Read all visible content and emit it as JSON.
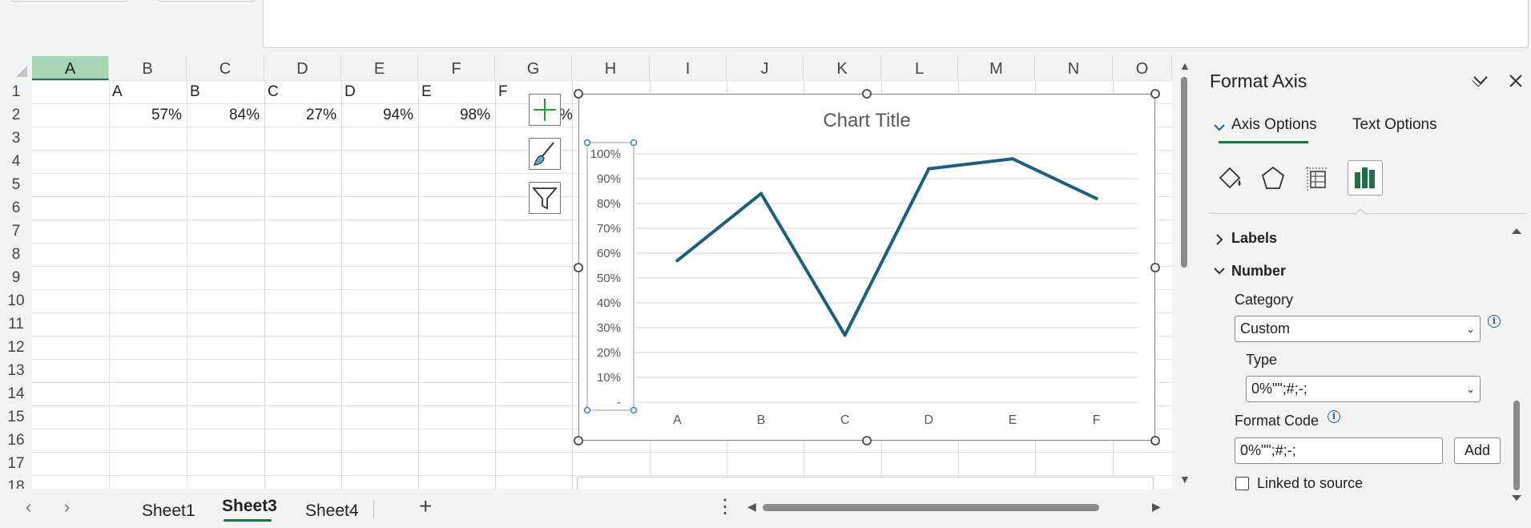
{
  "columns": [
    "A",
    "B",
    "C",
    "D",
    "E",
    "F",
    "G",
    "H",
    "I",
    "J",
    "K",
    "L",
    "M",
    "N",
    "O"
  ],
  "rows": [
    "1",
    "2",
    "3",
    "4",
    "5",
    "6",
    "7",
    "8",
    "9",
    "10",
    "11",
    "12",
    "13",
    "14",
    "15",
    "16",
    "17",
    "18"
  ],
  "cells": {
    "row1": [
      "A",
      "B",
      "C",
      "D",
      "E",
      "F"
    ],
    "row2": [
      "57%",
      "84%",
      "27%",
      "94%",
      "98%"
    ],
    "overflow_glyph": "%"
  },
  "sheets": [
    "Sheet1",
    "Sheet3",
    "Sheet4"
  ],
  "active_sheet": "Sheet3",
  "accent_color": "#1e7145",
  "series_color": "#1b5e7e",
  "chart_data": {
    "type": "line",
    "title": "Chart Title",
    "categories": [
      "A",
      "B",
      "C",
      "D",
      "E",
      "F"
    ],
    "series": [
      {
        "values": [
          0.57,
          0.84,
          0.27,
          0.94,
          0.98,
          0.82
        ]
      }
    ],
    "y_tick_labels": [
      "100%",
      "90%",
      "80%",
      "70%",
      "60%",
      "50%",
      "40%",
      "30%",
      "20%",
      "10%",
      "-"
    ],
    "ylim": [
      0,
      1
    ],
    "grid": true,
    "legend": "none"
  },
  "pane": {
    "title": "Format Axis",
    "tabs": [
      "Axis Options",
      "Text Options"
    ],
    "icons": [
      "fill-line-icon",
      "effects-icon",
      "size-properties-icon",
      "axis-options-icon"
    ],
    "sections": {
      "labels": "Labels",
      "number": "Number"
    },
    "category_label": "Category",
    "category_value": "Custom",
    "type_label": "Type",
    "type_value": "0%\"\";#;-;",
    "format_code_label": "Format Code",
    "format_code_value": "0%\"\";#;-;",
    "add_label": "Add",
    "linked_label": "Linked to source"
  }
}
